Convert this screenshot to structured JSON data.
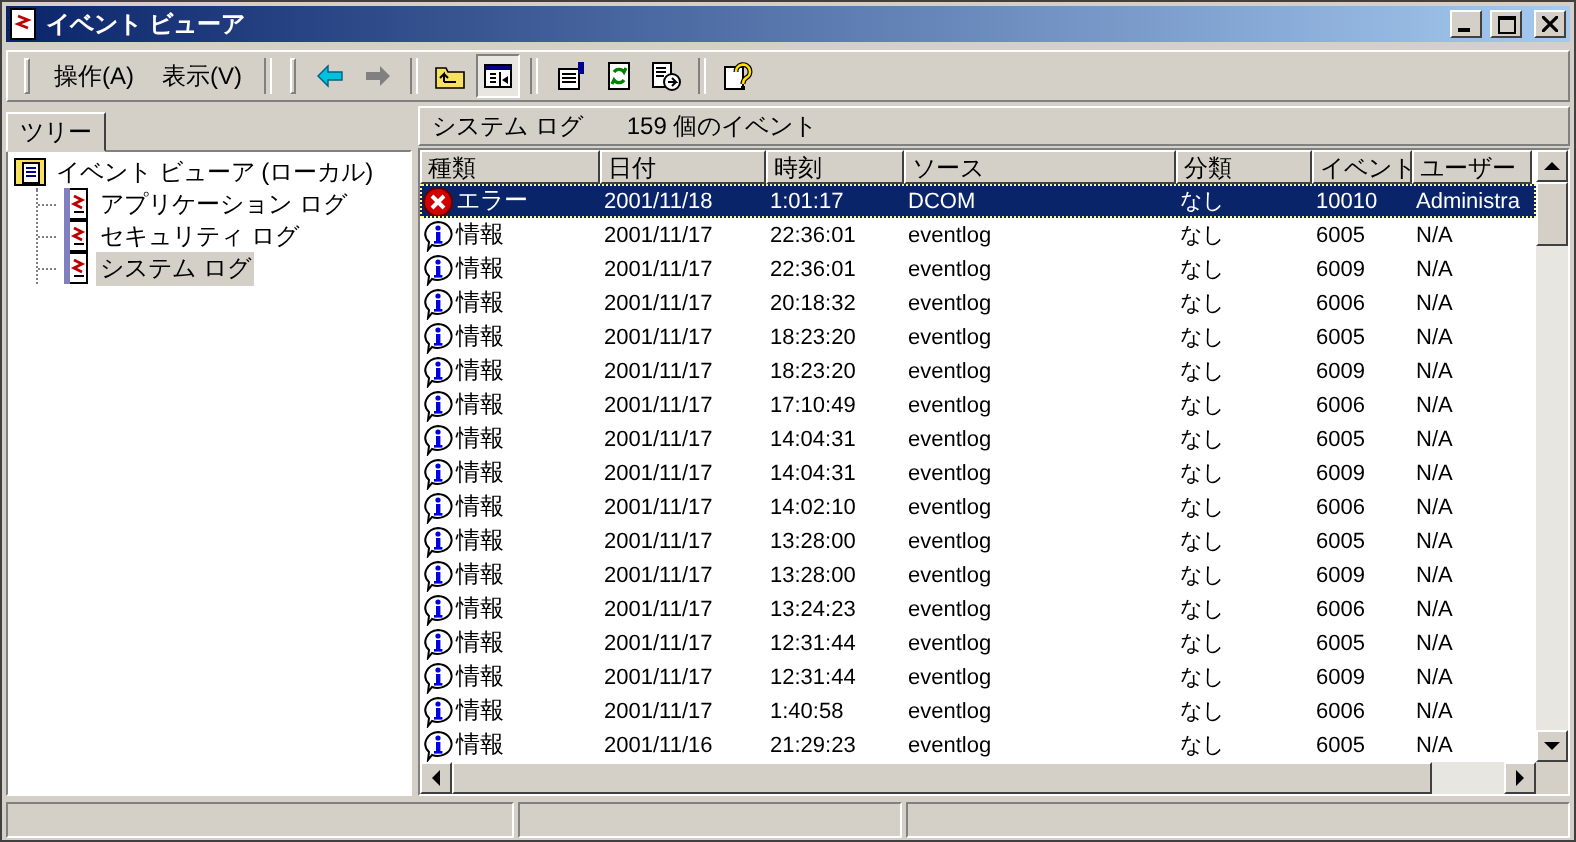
{
  "window": {
    "title": "イベント ビューア"
  },
  "menu": [
    {
      "label": "操作(A)"
    },
    {
      "label": "表示(V)"
    }
  ],
  "toolbar": [
    {
      "kind": "back",
      "disabled": false,
      "pressed": false
    },
    {
      "kind": "forward",
      "disabled": true,
      "pressed": false
    },
    {
      "kind": "sep"
    },
    {
      "kind": "up",
      "pressed": false
    },
    {
      "kind": "tree",
      "pressed": true
    },
    {
      "kind": "sep"
    },
    {
      "kind": "properties",
      "pressed": false
    },
    {
      "kind": "refresh",
      "pressed": false
    },
    {
      "kind": "export",
      "pressed": false
    },
    {
      "kind": "sep"
    },
    {
      "kind": "help",
      "pressed": false
    }
  ],
  "tree_pane": {
    "tab": "ツリー",
    "items": [
      {
        "label": "イベント ビューア (ローカル)",
        "expanded": true,
        "selected": false,
        "children": [
          {
            "label": "アプリケーション ログ",
            "selected": false
          },
          {
            "label": "セキュリティ ログ",
            "selected": false
          },
          {
            "label": "システム ログ",
            "selected": true
          }
        ]
      }
    ]
  },
  "list_pane": {
    "title": "システム ログ",
    "count": "159 個のイベント",
    "columns": [
      "種類",
      "日付",
      "時刻",
      "ソース",
      "分類",
      "イベント",
      "ユーザー"
    ],
    "rows": [
      {
        "kind": "error",
        "type": "エラー",
        "date": "2001/11/18",
        "time": "1:01:17",
        "source": "DCOM",
        "category": "なし",
        "event": "10010",
        "user": "Administra",
        "selected": true
      },
      {
        "kind": "info",
        "type": "情報",
        "date": "2001/11/17",
        "time": "22:36:01",
        "source": "eventlog",
        "category": "なし",
        "event": "6005",
        "user": "N/A",
        "selected": false
      },
      {
        "kind": "info",
        "type": "情報",
        "date": "2001/11/17",
        "time": "22:36:01",
        "source": "eventlog",
        "category": "なし",
        "event": "6009",
        "user": "N/A",
        "selected": false
      },
      {
        "kind": "info",
        "type": "情報",
        "date": "2001/11/17",
        "time": "20:18:32",
        "source": "eventlog",
        "category": "なし",
        "event": "6006",
        "user": "N/A",
        "selected": false
      },
      {
        "kind": "info",
        "type": "情報",
        "date": "2001/11/17",
        "time": "18:23:20",
        "source": "eventlog",
        "category": "なし",
        "event": "6005",
        "user": "N/A",
        "selected": false
      },
      {
        "kind": "info",
        "type": "情報",
        "date": "2001/11/17",
        "time": "18:23:20",
        "source": "eventlog",
        "category": "なし",
        "event": "6009",
        "user": "N/A",
        "selected": false
      },
      {
        "kind": "info",
        "type": "情報",
        "date": "2001/11/17",
        "time": "17:10:49",
        "source": "eventlog",
        "category": "なし",
        "event": "6006",
        "user": "N/A",
        "selected": false
      },
      {
        "kind": "info",
        "type": "情報",
        "date": "2001/11/17",
        "time": "14:04:31",
        "source": "eventlog",
        "category": "なし",
        "event": "6005",
        "user": "N/A",
        "selected": false
      },
      {
        "kind": "info",
        "type": "情報",
        "date": "2001/11/17",
        "time": "14:04:31",
        "source": "eventlog",
        "category": "なし",
        "event": "6009",
        "user": "N/A",
        "selected": false
      },
      {
        "kind": "info",
        "type": "情報",
        "date": "2001/11/17",
        "time": "14:02:10",
        "source": "eventlog",
        "category": "なし",
        "event": "6006",
        "user": "N/A",
        "selected": false
      },
      {
        "kind": "info",
        "type": "情報",
        "date": "2001/11/17",
        "time": "13:28:00",
        "source": "eventlog",
        "category": "なし",
        "event": "6005",
        "user": "N/A",
        "selected": false
      },
      {
        "kind": "info",
        "type": "情報",
        "date": "2001/11/17",
        "time": "13:28:00",
        "source": "eventlog",
        "category": "なし",
        "event": "6009",
        "user": "N/A",
        "selected": false
      },
      {
        "kind": "info",
        "type": "情報",
        "date": "2001/11/17",
        "time": "13:24:23",
        "source": "eventlog",
        "category": "なし",
        "event": "6006",
        "user": "N/A",
        "selected": false
      },
      {
        "kind": "info",
        "type": "情報",
        "date": "2001/11/17",
        "time": "12:31:44",
        "source": "eventlog",
        "category": "なし",
        "event": "6005",
        "user": "N/A",
        "selected": false
      },
      {
        "kind": "info",
        "type": "情報",
        "date": "2001/11/17",
        "time": "12:31:44",
        "source": "eventlog",
        "category": "なし",
        "event": "6009",
        "user": "N/A",
        "selected": false
      },
      {
        "kind": "info",
        "type": "情報",
        "date": "2001/11/17",
        "time": "1:40:58",
        "source": "eventlog",
        "category": "なし",
        "event": "6006",
        "user": "N/A",
        "selected": false
      },
      {
        "kind": "info",
        "type": "情報",
        "date": "2001/11/16",
        "time": "21:29:23",
        "source": "eventlog",
        "category": "なし",
        "event": "6005",
        "user": "N/A",
        "selected": false
      }
    ]
  }
}
